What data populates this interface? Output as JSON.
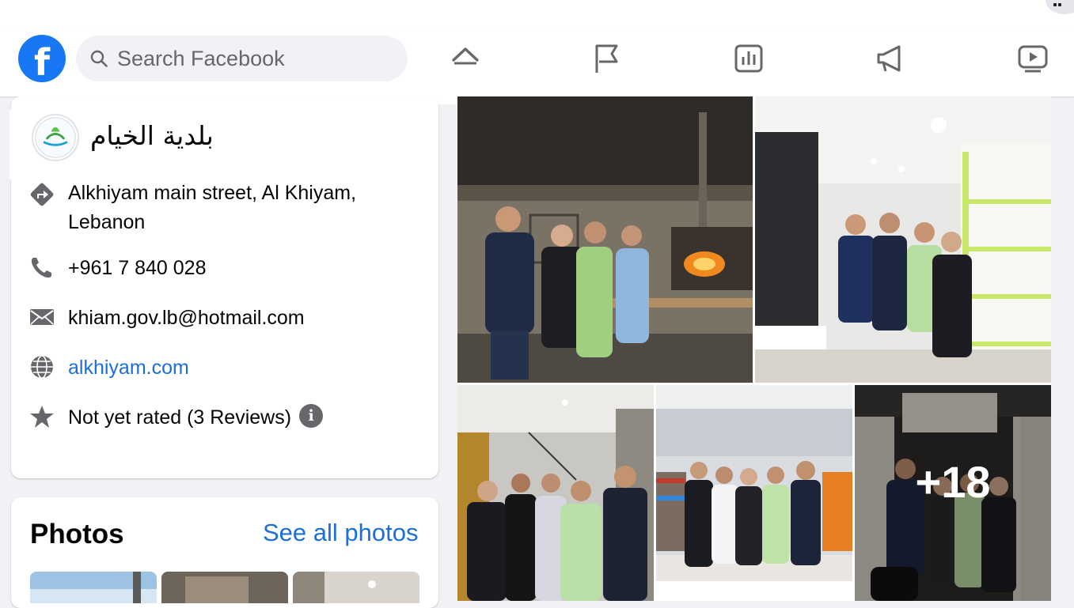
{
  "header": {
    "logo_letter": "f",
    "search": {
      "placeholder": "Search Facebook"
    },
    "nav": [
      {
        "name": "home-icon"
      },
      {
        "name": "flag-icon"
      },
      {
        "name": "chart-icon"
      },
      {
        "name": "megaphone-icon"
      },
      {
        "name": "video-icon"
      }
    ]
  },
  "colors": {
    "brand": "#1877f2",
    "link": "#1a6fd8",
    "icon_gray": "#65676b",
    "page_bg": "#f0f2f5"
  },
  "intro": {
    "page_name": "بلدية الخيام",
    "address_line1": "Alkhiyam main street, Al Khiyam,",
    "address_line2": "Lebanon",
    "phone": "+961 7 840 028",
    "email": "khiam.gov.lb@hotmail.com",
    "website": "alkhiyam.com",
    "rating": "Not yet rated (3 Reviews)",
    "rating_info": "i"
  },
  "photos": {
    "title": "Photos",
    "see_all": "See all photos"
  },
  "post": {
    "more_count": "+18"
  }
}
